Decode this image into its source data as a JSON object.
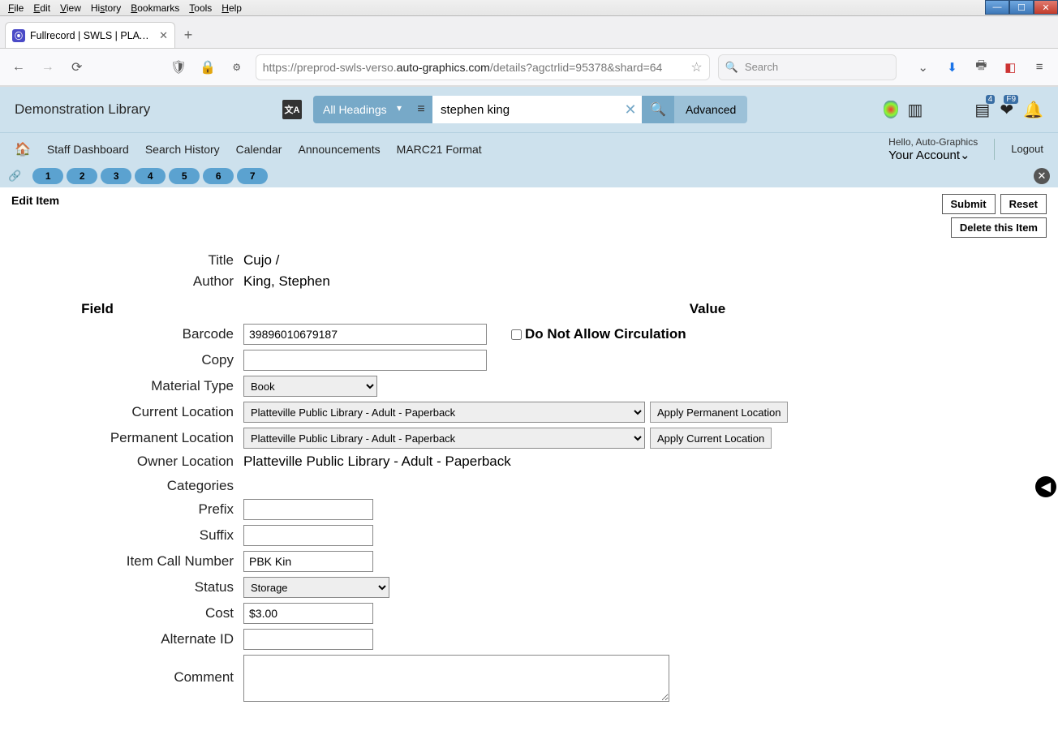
{
  "browser": {
    "menus": [
      "File",
      "Edit",
      "View",
      "History",
      "Bookmarks",
      "Tools",
      "Help"
    ],
    "tab_title": "Fullrecord | SWLS | PLATT | Autc",
    "url_prefix": "https://preprod-swls-verso.",
    "url_host": "auto-graphics.com",
    "url_suffix": "/details?agctrlid=95378&shard=64",
    "search_placeholder": "Search"
  },
  "header": {
    "brand": "Demonstration Library",
    "headsel": "All Headings",
    "search_value": "stephen king",
    "advanced": "Advanced",
    "badge_count": "4",
    "fav_badge": "F9"
  },
  "nav": {
    "items": [
      "Staff Dashboard",
      "Search History",
      "Calendar",
      "Announcements",
      "MARC21 Format"
    ],
    "hello": "Hello, Auto-Graphics",
    "your_account": "Your Account",
    "logout": "Logout"
  },
  "crumbs": [
    "1",
    "2",
    "3",
    "4",
    "5",
    "6",
    "7"
  ],
  "actions": {
    "edit_item": "Edit Item",
    "submit": "Submit",
    "reset": "Reset",
    "delete": "Delete this Item"
  },
  "form": {
    "title_label": "Title",
    "title_value": "Cujo /",
    "author_label": "Author",
    "author_value": "King, Stephen",
    "field_hdr": "Field",
    "value_hdr": "Value",
    "barcode_label": "Barcode",
    "barcode_value": "39896010679187",
    "dnac_label": "Do Not Allow Circulation",
    "copy_label": "Copy",
    "copy_value": "",
    "material_label": "Material Type",
    "material_value": "Book",
    "curloc_label": "Current Location",
    "curloc_value": "Platteville Public Library - Adult - Paperback",
    "apply_perm": "Apply Permanent Location",
    "permloc_label": "Permanent Location",
    "permloc_value": "Platteville Public Library - Adult - Paperback",
    "apply_cur": "Apply Current Location",
    "ownerloc_label": "Owner Location",
    "ownerloc_value": "Platteville Public Library - Adult - Paperback",
    "categories_label": "Categories",
    "prefix_label": "Prefix",
    "prefix_value": "",
    "suffix_label": "Suffix",
    "suffix_value": "",
    "calln_label": "Item Call Number",
    "calln_value": "PBK Kin",
    "status_label": "Status",
    "status_value": "Storage",
    "cost_label": "Cost",
    "cost_value": "$3.00",
    "altid_label": "Alternate ID",
    "altid_value": "",
    "comment_label": "Comment",
    "comment_value": ""
  }
}
